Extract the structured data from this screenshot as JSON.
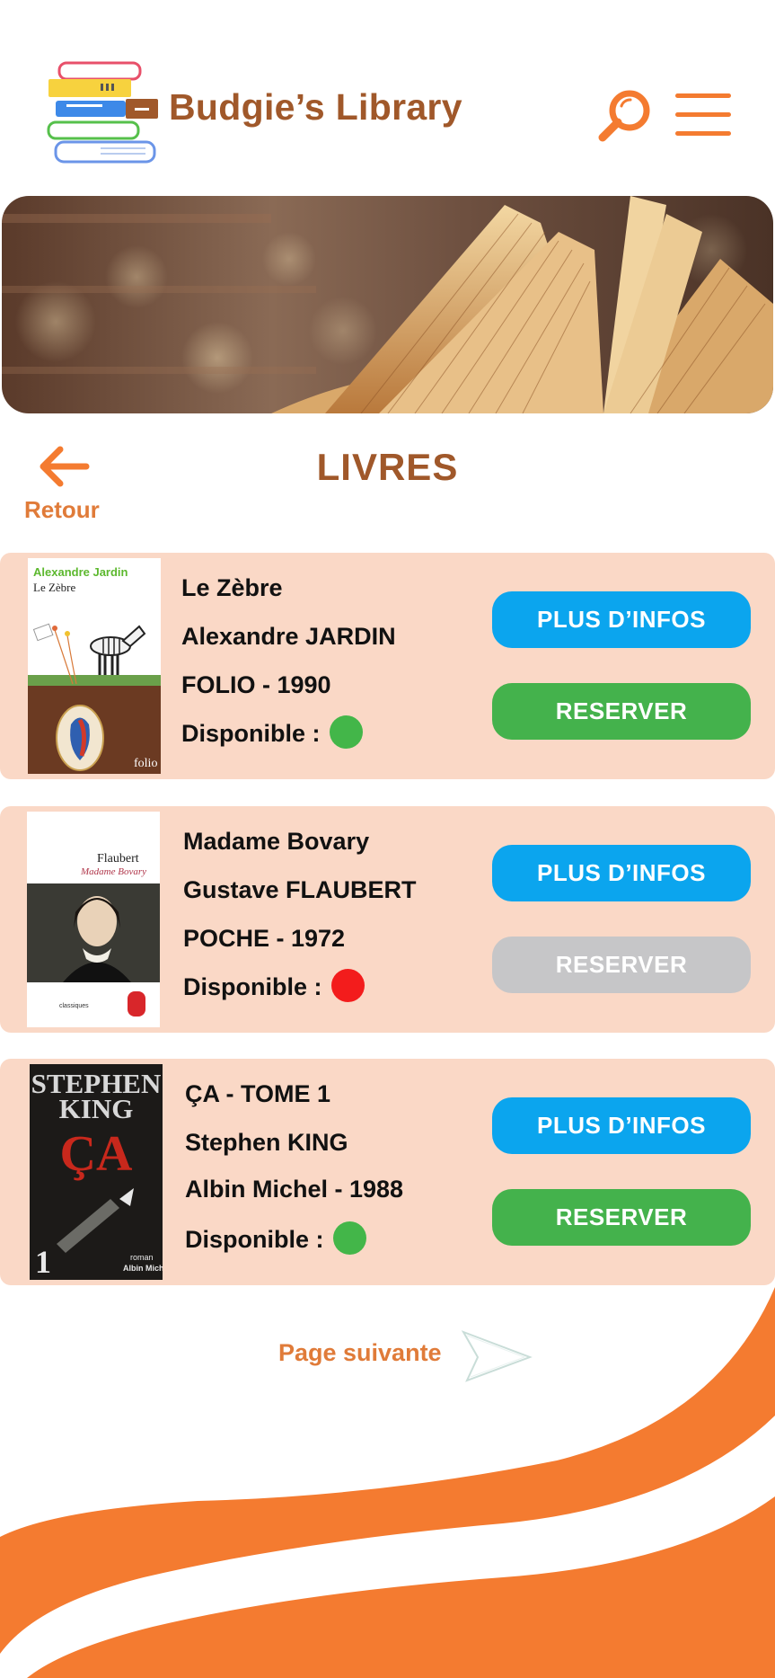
{
  "header": {
    "app_title": "Budgie’s Library"
  },
  "hero": {
    "image": "open-book-in-library"
  },
  "nav": {
    "back_label": "Retour",
    "page_title": "LIVRES"
  },
  "books": [
    {
      "title": "Le Zèbre",
      "author": "Alexandre JARDIN",
      "publisher_year": "FOLIO - 1990",
      "availability_label": "Disponible :",
      "available": true,
      "info_label": "PLUS D’INFOS",
      "reserve_label": "RESERVER",
      "cover": {
        "author": "Alexandre Jardin",
        "title": "Le Zèbre",
        "imprint": "folio"
      }
    },
    {
      "title": "Madame Bovary",
      "author": "Gustave FLAUBERT",
      "publisher_year": "POCHE - 1972",
      "availability_label": "Disponible :",
      "available": false,
      "info_label": "PLUS D’INFOS",
      "reserve_label": "RESERVER",
      "cover": {
        "author": "Flaubert",
        "title": "Madame Bovary",
        "imprint": "classiques"
      }
    },
    {
      "title": "ÇA - TOME 1",
      "author": "Stephen KING",
      "publisher_year": "Albin Michel - 1988",
      "availability_label": "Disponible :",
      "available": true,
      "info_label": "PLUS D’INFOS",
      "reserve_label": "RESERVER",
      "cover": {
        "author_line1": "STEPHEN",
        "author_line2": "KING",
        "title": "ÇA",
        "volume": "1",
        "imprint_line1": "roman",
        "imprint_line2": "Albin Michel"
      }
    }
  ],
  "pagination": {
    "next_label": "Page suivante"
  },
  "colors": {
    "brand_brown": "#a0582a",
    "accent_orange": "#f47b30",
    "card_bg": "#fad8c6",
    "info_blue": "#0ba5ee",
    "reserve_green": "#44b24c",
    "disabled_gray": "#c6c6c8",
    "available_green": "#43b649",
    "unavailable_red": "#f31c1c"
  },
  "icons": {
    "logo": "stacked-books-icon",
    "search": "search-icon",
    "menu": "hamburger-menu-icon",
    "back": "arrow-left-icon",
    "next": "chevron-right-icon"
  }
}
